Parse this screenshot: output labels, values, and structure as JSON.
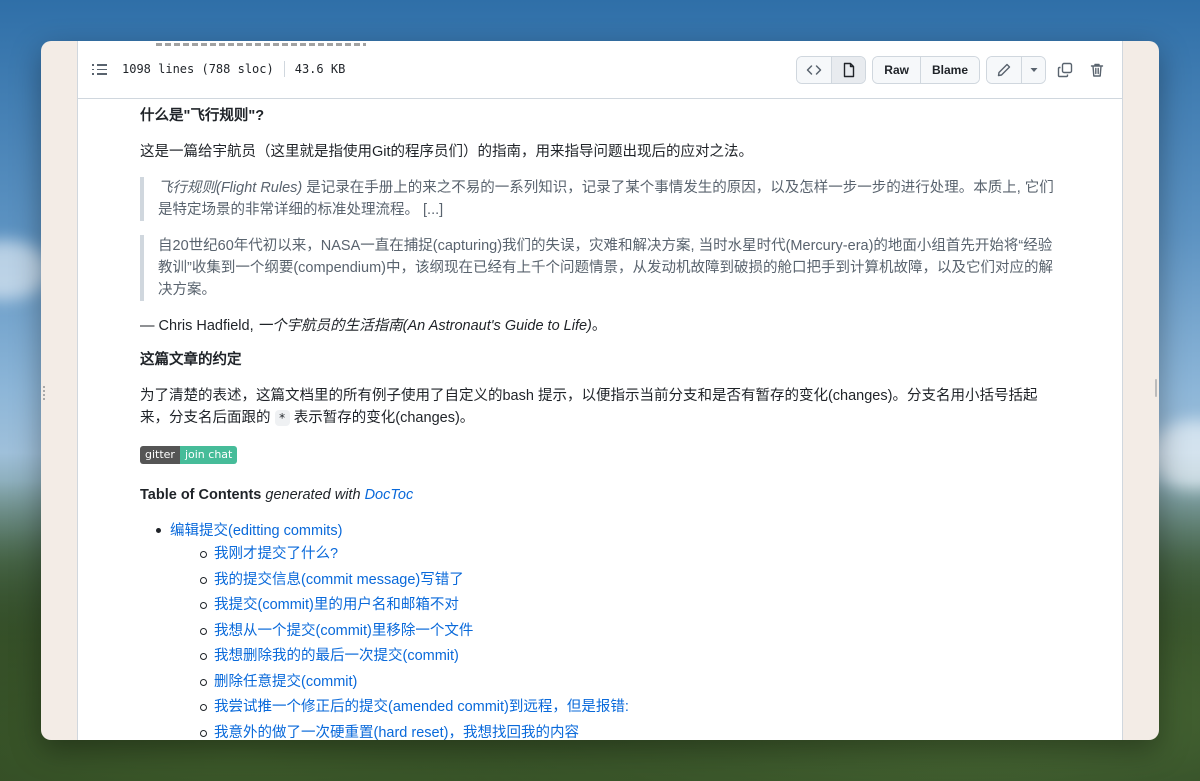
{
  "file_header": {
    "lines_info": "1098 lines (788 sloc)",
    "size": "43.6 KB",
    "raw_label": "Raw",
    "blame_label": "Blame",
    "icons": [
      "list-icon",
      "code-icon",
      "file-icon",
      "pencil-icon",
      "chevron-down-icon",
      "copy-icon",
      "trash-icon"
    ]
  },
  "article": {
    "heading1": "什么是\"飞行规则\"?",
    "intro": "这是一篇给宇航员（这里就是指使用Git的程序员们）的指南，用来指导问题出现后的应对之法。",
    "quote1_em": "飞行规则(Flight Rules)",
    "quote1_rest": " 是记录在手册上的来之不易的一系列知识，记录了某个事情发生的原因，以及怎样一步一步的进行处理。本质上, 它们是特定场景的非常详细的标准处理流程。 [...]",
    "quote2": "自20世纪60年代初以来，NASA一直在捕捉(capturing)我们的失误，灾难和解决方案, 当时水星时代(Mercury-era)的地面小组首先开始将“经验教训”收集到一个纲要(compendium)中，该纲现在已经有上千个问题情景，从发动机故障到破损的舱口把手到计算机故障，以及它们对应的解决方案。",
    "attribution_prefix": "— Chris Hadfield, ",
    "attribution_em": "一个宇航员的生活指南(An Astronaut's Guide to Life)",
    "attribution_suffix": "。",
    "heading2": "这篇文章的约定",
    "convention_a": "为了清楚的表述，这篇文档里的所有例子使用了自定义的bash 提示，以便指示当前分支和是否有暂存的变化(changes)。分支名用小括号括起来，分支名后面跟的 ",
    "convention_code": "*",
    "convention_b": " 表示暂存的变化(changes)。",
    "badge_left": "gitter",
    "badge_right": "join chat",
    "toc_title": "Table of Contents",
    "toc_generated": " generated with ",
    "toc_link": "DocToc"
  },
  "toc": {
    "main_item": "编辑提交(editting commits)",
    "sub_items": [
      "我刚才提交了什么?",
      "我的提交信息(commit message)写错了",
      "我提交(commit)里的用户名和邮箱不对",
      "我想从一个提交(commit)里移除一个文件",
      "我想删除我的的最后一次提交(commit)",
      "删除任意提交(commit)",
      "我尝试推一个修正后的提交(amended commit)到远程，但是报错:",
      "我意外的做了一次硬重置(hard reset)，我想找回我的内容"
    ]
  }
}
